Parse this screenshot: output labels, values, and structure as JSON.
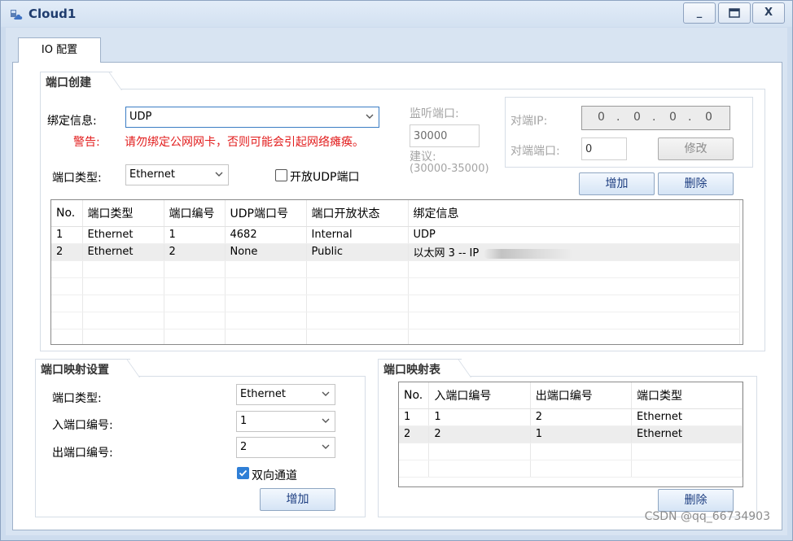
{
  "window": {
    "title": "Cloud1",
    "minimize_label": "_",
    "close_label": "X"
  },
  "tabs": [
    {
      "label": "IO 配置"
    }
  ],
  "port_create": {
    "legend": "端口创建",
    "binding_label": "绑定信息:",
    "binding_value": "UDP",
    "warning_label": "警告:",
    "warning_text": "请勿绑定公网网卡，否则可能会引起网络瘫痪。",
    "port_type_label": "端口类型:",
    "port_type_value": "Ethernet",
    "open_udp_label": "开放UDP端口",
    "open_udp_checked": false,
    "listen_port_label": "监听端口:",
    "listen_port_value": "30000",
    "suggest_label": "建议:",
    "suggest_range": "(30000-35000)",
    "peer_ip_label": "对端IP:",
    "peer_ip_octets": [
      "0",
      "0",
      "0",
      "0"
    ],
    "peer_ip_dot": ".",
    "peer_port_label": "对端端口:",
    "peer_port_value": "0",
    "modify_button": "修改",
    "add_button": "增加",
    "delete_button": "删除",
    "table": {
      "columns": [
        "No.",
        "端口类型",
        "端口编号",
        "UDP端口号",
        "端口开放状态",
        "绑定信息"
      ],
      "rows": [
        [
          "1",
          "Ethernet",
          "1",
          "4682",
          "Internal",
          "UDP"
        ],
        [
          "2",
          "Ethernet",
          "2",
          "None",
          "Public",
          "以太网 3 -- IP"
        ]
      ]
    }
  },
  "port_mapping_settings": {
    "legend": "端口映射设置",
    "port_type_label": "端口类型:",
    "port_type_value": "Ethernet",
    "in_port_label": "入端口编号:",
    "in_port_value": "1",
    "out_port_label": "出端口编号:",
    "out_port_value": "2",
    "bidirectional_label": "双向通道",
    "bidirectional_checked": true,
    "add_button": "增加"
  },
  "port_mapping_table": {
    "legend": "端口映射表",
    "columns": [
      "No.",
      "入端口编号",
      "出端口编号",
      "端口类型"
    ],
    "rows": [
      [
        "1",
        "1",
        "2",
        "Ethernet"
      ],
      [
        "2",
        "2",
        "1",
        "Ethernet"
      ]
    ],
    "delete_button": "删除"
  },
  "watermark": "CSDN @qq_66734903",
  "colors": {
    "accent": "#2f7fd6",
    "warning": "#e21d1d",
    "title": "#1f3c6e"
  }
}
